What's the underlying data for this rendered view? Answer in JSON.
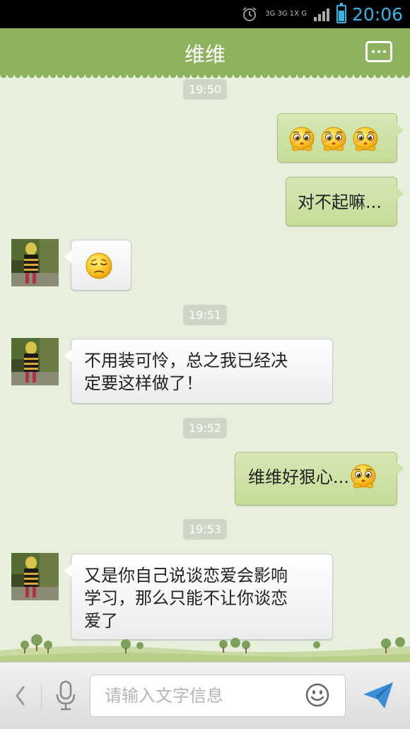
{
  "status_bar": {
    "network_top": "3G 3G 1X G",
    "time": "20:06"
  },
  "header": {
    "title": "维维",
    "more_icon": "more-icon"
  },
  "messages": [
    {
      "type": "time",
      "text": "19:50"
    },
    {
      "type": "out",
      "text": "",
      "emojis": [
        "pitiful",
        "pitiful",
        "pitiful"
      ]
    },
    {
      "type": "out",
      "text": "对不起嘛..."
    },
    {
      "type": "in",
      "text": "",
      "emojis": [
        "sad"
      ]
    },
    {
      "type": "time",
      "text": "19:51"
    },
    {
      "type": "in",
      "text_lines": [
        "不用装可怜，总之我已经决",
        "定要这样做了！"
      ]
    },
    {
      "type": "time",
      "text": "19:52"
    },
    {
      "type": "out",
      "text": "维维好狠心...",
      "emojis": [
        "pitiful"
      ]
    },
    {
      "type": "time",
      "text": "19:53"
    },
    {
      "type": "in",
      "text_lines": [
        "又是你自己说谈恋爱会影响",
        "学习，那么只能不让你谈恋",
        "爱了"
      ]
    }
  ],
  "input_bar": {
    "placeholder": "请输入文字信息",
    "value": ""
  },
  "colors": {
    "header_green": "#8cb15b",
    "outgoing_bubble": "#c5dc98",
    "background": "#e8efdd",
    "clock_blue": "#33b5e5"
  }
}
